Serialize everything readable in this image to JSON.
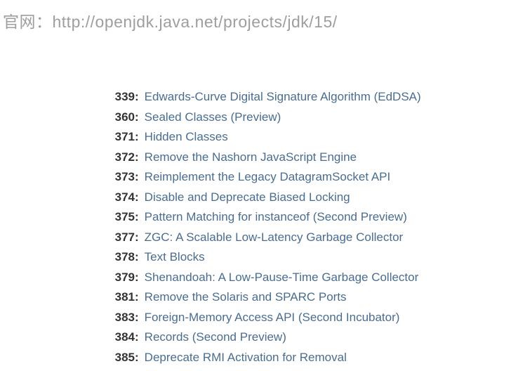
{
  "header": {
    "label": "官网：",
    "url": "http://openjdk.java.net/projects/jdk/15/"
  },
  "jeps": [
    {
      "id": "339",
      "title": "Edwards-Curve Digital Signature Algorithm (EdDSA)"
    },
    {
      "id": "360",
      "title": "Sealed Classes (Preview)"
    },
    {
      "id": "371",
      "title": "Hidden Classes"
    },
    {
      "id": "372",
      "title": "Remove the Nashorn JavaScript Engine"
    },
    {
      "id": "373",
      "title": "Reimplement the Legacy DatagramSocket API"
    },
    {
      "id": "374",
      "title": "Disable and Deprecate Biased Locking"
    },
    {
      "id": "375",
      "title": "Pattern Matching for instanceof (Second Preview)"
    },
    {
      "id": "377",
      "title": "ZGC: A Scalable Low-Latency Garbage Collector"
    },
    {
      "id": "378",
      "title": "Text Blocks"
    },
    {
      "id": "379",
      "title": "Shenandoah: A Low-Pause-Time Garbage Collector"
    },
    {
      "id": "381",
      "title": "Remove the Solaris and SPARC Ports"
    },
    {
      "id": "383",
      "title": "Foreign-Memory Access API (Second Incubator)"
    },
    {
      "id": "384",
      "title": "Records (Second Preview)"
    },
    {
      "id": "385",
      "title": "Deprecate RMI Activation for Removal"
    }
  ]
}
